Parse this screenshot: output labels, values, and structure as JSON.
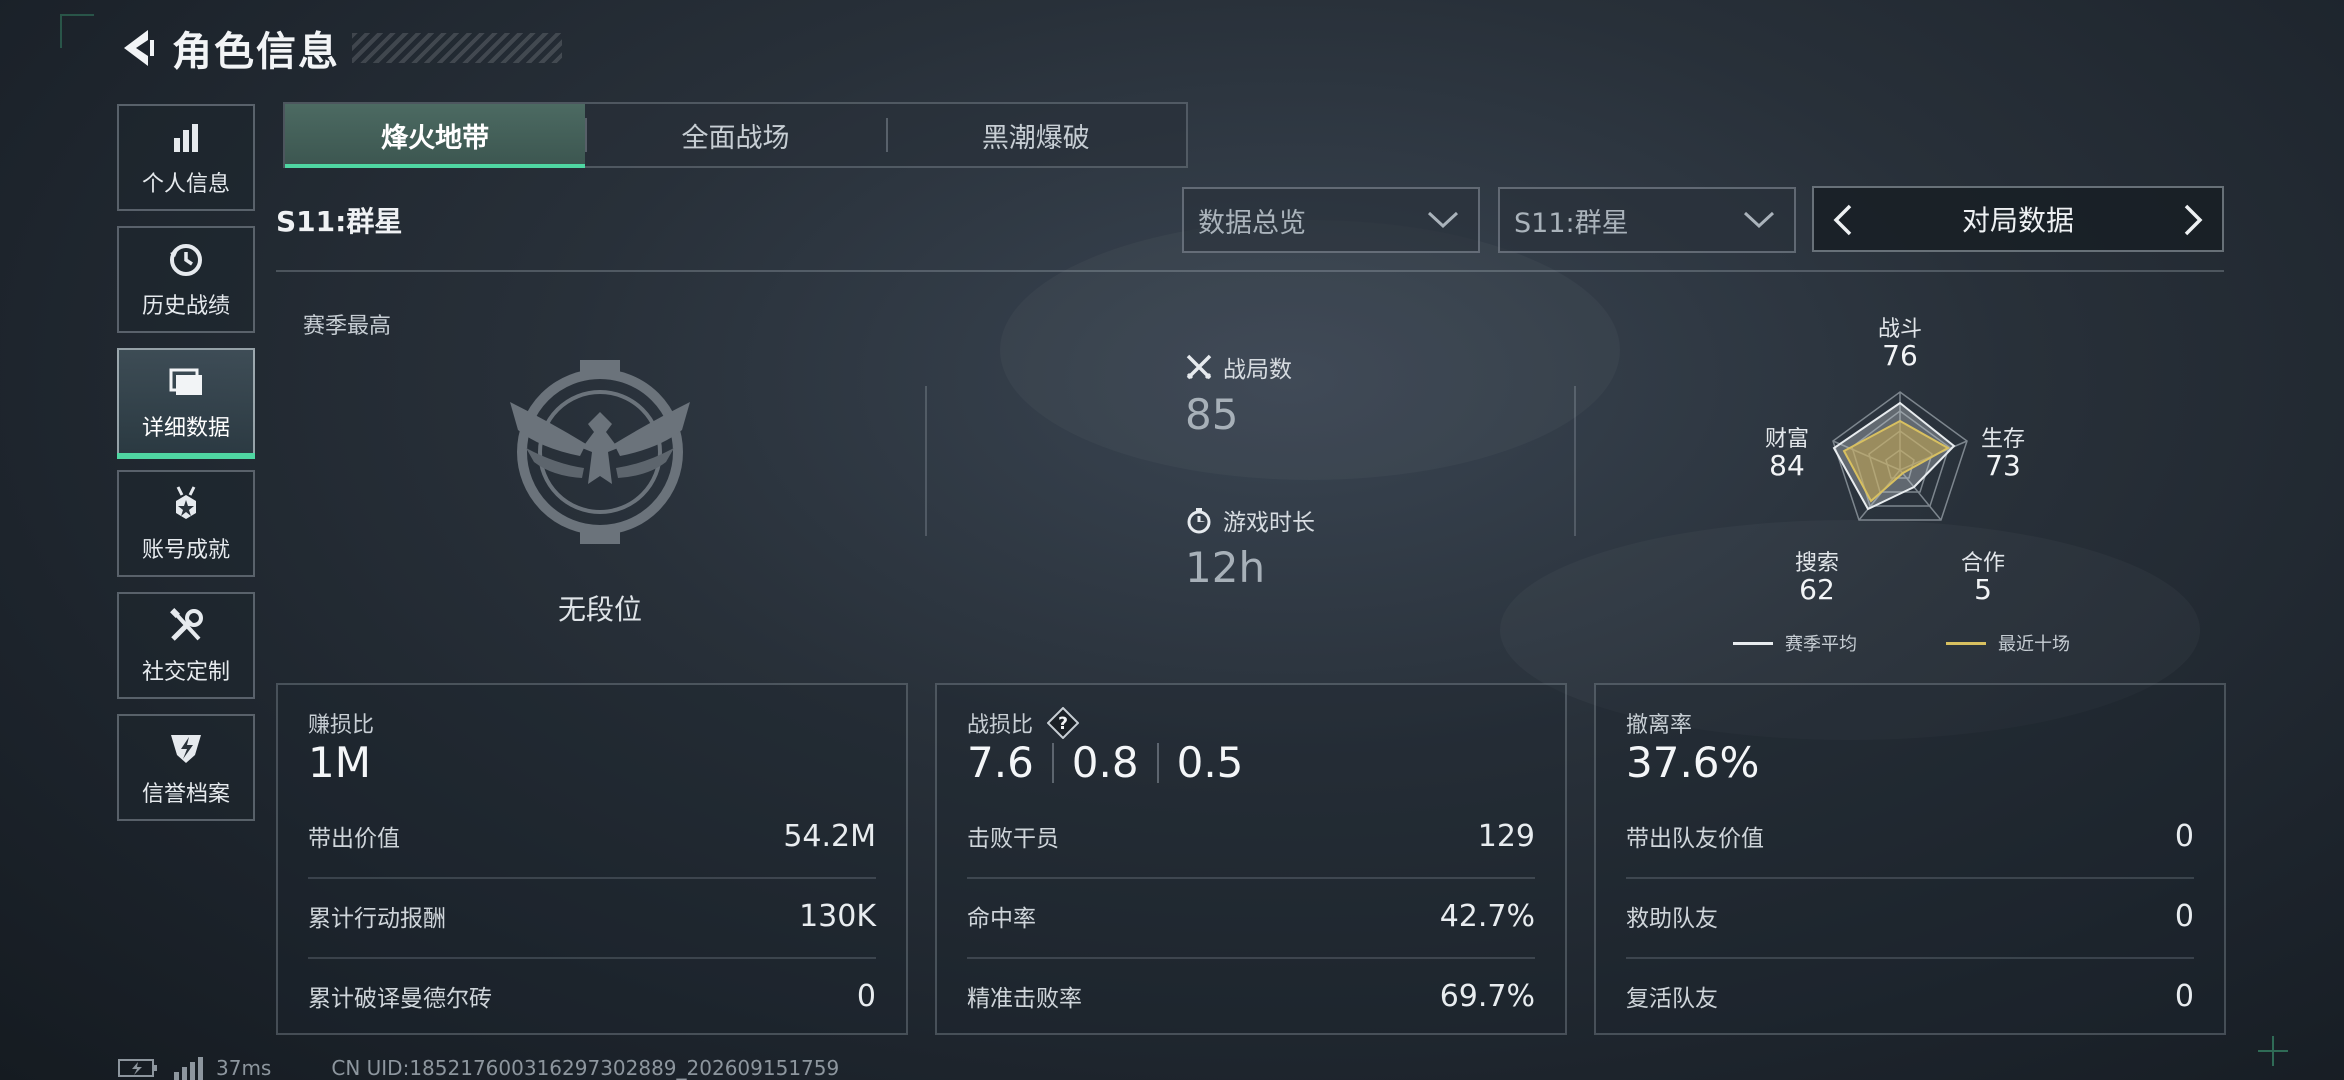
{
  "header": {
    "title": "角色信息"
  },
  "sidebar": {
    "items": [
      {
        "label": "个人信息",
        "icon": "bar-chart-icon"
      },
      {
        "label": "历史战绩",
        "icon": "history-clock-icon"
      },
      {
        "label": "详细数据",
        "icon": "folder-icon",
        "active": true
      },
      {
        "label": "账号成就",
        "icon": "medal-icon"
      },
      {
        "label": "社交定制",
        "icon": "tools-icon"
      },
      {
        "label": "信誉档案",
        "icon": "shield-emblem-icon"
      }
    ]
  },
  "tabs": [
    {
      "label": "烽火地带",
      "active": true
    },
    {
      "label": "全面战场"
    },
    {
      "label": "黑潮爆破"
    }
  ],
  "season_title": "S11:群星",
  "filters": {
    "overview": "数据总览",
    "season": "S11:群星",
    "pager_label": "对局数据"
  },
  "season_best": {
    "label": "赛季最高",
    "rank": "无段位"
  },
  "stats": {
    "matches_label": "战局数",
    "matches_value": "85",
    "playtime_label": "游戏时长",
    "playtime_value": "12h"
  },
  "radar": {
    "axes": [
      {
        "label": "战斗",
        "value": "76"
      },
      {
        "label": "生存",
        "value": "73"
      },
      {
        "label": "合作",
        "value": "5"
      },
      {
        "label": "搜索",
        "value": "62"
      },
      {
        "label": "财富",
        "value": "84"
      }
    ],
    "legend": {
      "season_avg": "赛季平均",
      "recent_ten": "最近十场"
    },
    "colors": {
      "season_avg": "#e8ecef",
      "recent_ten": "#d8c060"
    }
  },
  "cards": {
    "profit": {
      "title": "赚损比",
      "main": "1M",
      "rows": [
        {
          "label": "带出价值",
          "value": "54.2M"
        },
        {
          "label": "累计行动报酬",
          "value": "130K"
        },
        {
          "label": "累计破译曼德尔砖",
          "value": "0"
        }
      ]
    },
    "combat": {
      "title": "战损比",
      "help": "?",
      "main": [
        "7.6",
        "0.8",
        "0.5"
      ],
      "rows": [
        {
          "label": "击败干员",
          "value": "129"
        },
        {
          "label": "命中率",
          "value": "42.7%"
        },
        {
          "label": "精准击败率",
          "value": "69.7%"
        }
      ]
    },
    "extract": {
      "title": "撤离率",
      "main": "37.6%",
      "rows": [
        {
          "label": "带出队友价值",
          "value": "0"
        },
        {
          "label": "救助队友",
          "value": "0"
        },
        {
          "label": "复活队友",
          "value": "0"
        }
      ]
    }
  },
  "footer": {
    "ping": "37ms",
    "uid": "CN UID:18521760031629730288​9_202609151759"
  },
  "colors": {
    "accent": "#4fd6a2"
  }
}
